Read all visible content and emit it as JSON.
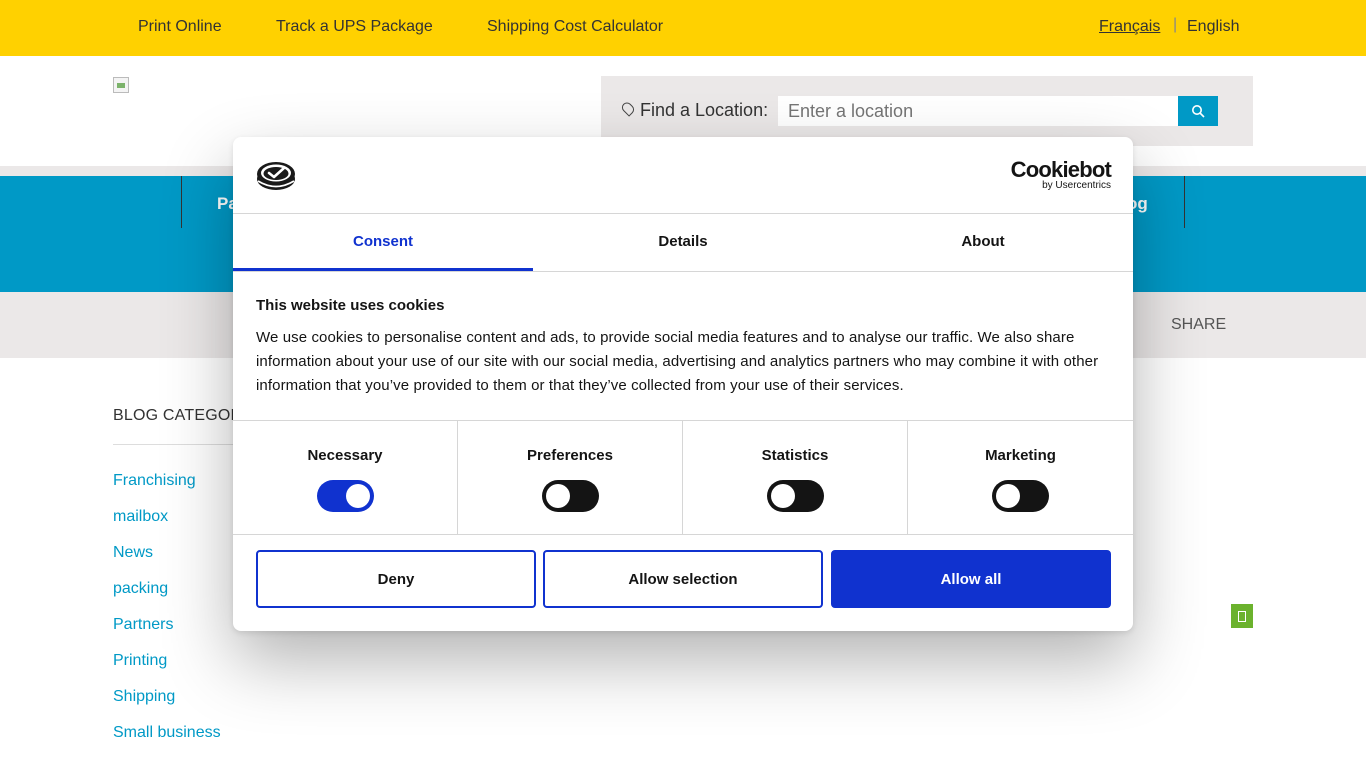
{
  "topbar": {
    "links": [
      "Print Online",
      "Track a UPS Package",
      "Shipping Cost Calculator"
    ],
    "lang_fr": "Français",
    "lang_sep": "|",
    "lang_en": "English"
  },
  "search": {
    "label": "Find a Location:",
    "placeholder": "Enter a location"
  },
  "nav": {
    "left_partial": "Pa",
    "right_partial": "og"
  },
  "sharebar": {
    "share_label": "SHARE"
  },
  "blog": {
    "title": "BLOG CATEGOR",
    "categories": [
      "Franchising",
      "mailbox",
      "News",
      "packing",
      "Partners",
      "Printing",
      "Shipping",
      "Small business"
    ]
  },
  "cookie": {
    "brand_name": "Cookiebot",
    "brand_sub": "by Usercentrics",
    "tabs": [
      "Consent",
      "Details",
      "About"
    ],
    "title": "This website uses cookies",
    "text": "We use cookies to personalise content and ads, to provide social media features and to analyse our traffic. We also share information about your use of our site with our social media, advertising and analytics partners who may combine it with other information that you’ve provided to them or that they’ve collected from your use of their services.",
    "toggles": [
      {
        "label": "Necessary",
        "on": true
      },
      {
        "label": "Preferences",
        "on": false
      },
      {
        "label": "Statistics",
        "on": false
      },
      {
        "label": "Marketing",
        "on": false
      }
    ],
    "buttons": {
      "deny": "Deny",
      "allow_selection": "Allow selection",
      "allow_all": "Allow all"
    }
  },
  "colors": {
    "topbar": "#ffd100",
    "nav": "#0099c6",
    "accent": "#1032cf",
    "link": "#0099c6",
    "share_button": "#6bb22d"
  }
}
